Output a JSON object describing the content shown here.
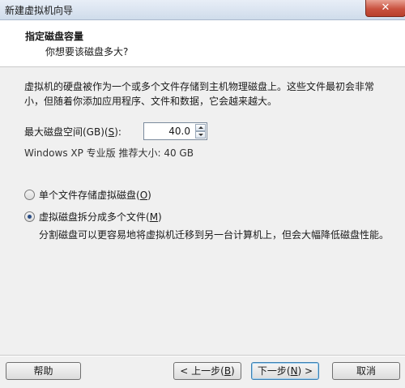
{
  "window": {
    "title": "新建虚拟机向导",
    "close_label": "✕"
  },
  "header": {
    "title": "指定磁盘容量",
    "subtitle": "你想要该磁盘多大?"
  },
  "description": "虚拟机的硬盘被作为一个或多个文件存储到主机物理磁盘上。这些文件最初会非常小，但随着你添加应用程序、文件和数据，它会越来越大。",
  "disk": {
    "label_prefix": "最大磁盘空间(GB)(",
    "label_key": "S",
    "label_suffix": "):",
    "value": "40.0",
    "recommendation": "Windows XP 专业版 推荐大小: 40 GB"
  },
  "options": {
    "single": {
      "prefix": "单个文件存储虚拟磁盘(",
      "key": "O",
      "suffix": ")",
      "checked": false
    },
    "split": {
      "prefix": "虚拟磁盘拆分成多个文件(",
      "key": "M",
      "suffix": ")",
      "checked": true
    },
    "split_hint": "分割磁盘可以更容易地将虚拟机迁移到另一台计算机上，但会大幅降低磁盘性能。"
  },
  "buttons": {
    "help": "帮助",
    "back_prefix": "< 上一步(",
    "back_key": "B",
    "back_suffix": ")",
    "next_prefix": "下一步(",
    "next_key": "N",
    "next_suffix": ") >",
    "cancel": "取消"
  }
}
